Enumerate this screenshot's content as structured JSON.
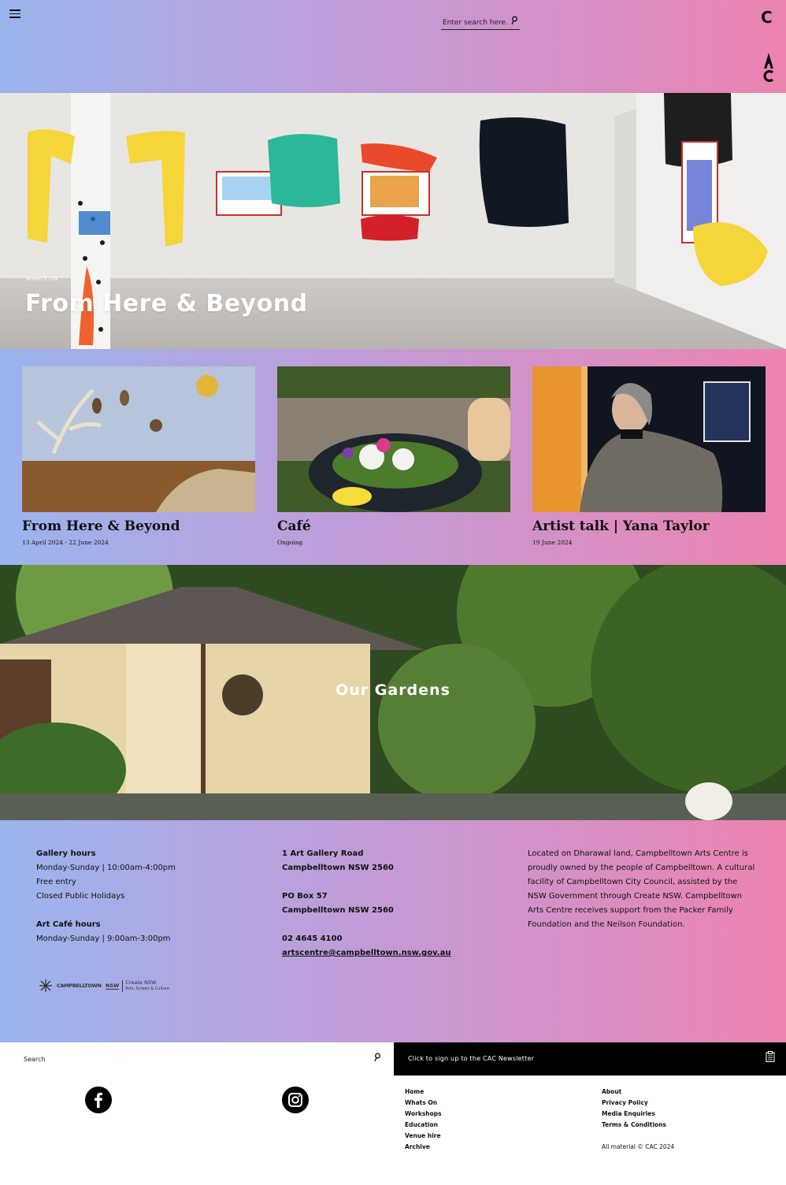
{
  "header": {
    "search_placeholder": "Enter search here...",
    "logo_top": "C"
  },
  "hero": {
    "kicker": "WHATS ON",
    "title": "From Here & Beyond"
  },
  "cards": [
    {
      "title": "From Here & Beyond",
      "date": "13 April 2024 - 22 June 2024"
    },
    {
      "title": "Café",
      "date": "Ongoing"
    },
    {
      "title": "Artist talk | Yana Taylor",
      "date": "19 June 2024"
    }
  ],
  "gardens": {
    "title": "Our Gardens"
  },
  "info": {
    "col1": {
      "gallery_heading": "Gallery hours",
      "gallery_days": "Monday-Sunday | 10:00am-4:00pm",
      "free_entry": "Free entry",
      "closed": "Closed Public Holidays",
      "cafe_heading": "Art Café hours",
      "cafe_days": "Monday-Sunday | 9:00am-3:00pm"
    },
    "col2": {
      "street": "1 Art Gallery Road",
      "suburb": "Campbelltown NSW 2560",
      "po_box": "PO Box 57",
      "po_suburb": "Campbelltown NSW 2560",
      "phone": "02 4645 4100",
      "email": "artscentre@campbelltown.nsw.gov.au"
    },
    "col3": {
      "acknowledgement": "Located on Dharawal land, Campbelltown Arts Centre is proudly owned by the people of Campbelltown. A cultural facility of Campbelltown City Council, assisted by the NSW Government through Create NSW. Campbelltown Arts Centre receives support from the Packer Family Foundation and the Neilson Foundation."
    },
    "sponsors": {
      "campbelltown": "CAMPBELLTOWN",
      "nsw": "NSW",
      "create_nsw": "Create NSW",
      "create_nsw_sub": "Arts, Screen & Culture"
    }
  },
  "footer": {
    "search_placeholder": "Search",
    "newsletter": "Click to sign up to the CAC Newsletter",
    "nav_left": [
      "Home",
      "Whats On",
      "Workshops",
      "Education",
      "Venue hire",
      "Archive"
    ],
    "nav_right": [
      "About",
      "Privacy Policy",
      "Media Enquiries",
      "Terms & Conditions"
    ],
    "copyright": "All material © CAC 2024"
  },
  "colors": {
    "gradient_left": "#9bb4ee",
    "gradient_mid": "#c49ad6",
    "gradient_right": "#ec83b0",
    "newsletter_bg": "#000000"
  },
  "icons": [
    "menu-icon",
    "search-icon",
    "cac-logo",
    "facebook-icon",
    "instagram-icon",
    "clipboard-icon"
  ]
}
